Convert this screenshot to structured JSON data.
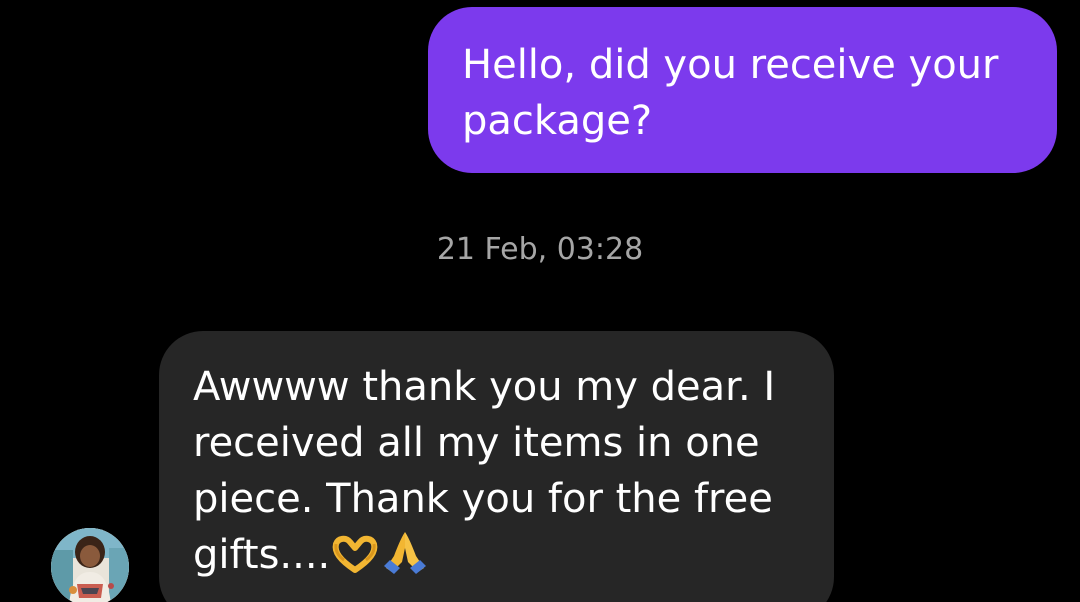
{
  "conversation": {
    "messages": [
      {
        "direction": "outgoing",
        "text": "Hello, did you receive your package?"
      },
      {
        "direction": "incoming",
        "text": "Awwww thank you my dear. I received all my items in one piece. Thank you for the free gifts...."
      }
    ],
    "timestamp": "21 Feb, 03:28",
    "incoming_emojis": [
      "heart-hands-emoji",
      "folded-hands-emoji"
    ]
  },
  "colors": {
    "background": "#000000",
    "outgoing_bubble": "#7c3aed",
    "incoming_bubble": "#262626",
    "timestamp_text": "#a6a6a6",
    "message_text": "#ffffff"
  }
}
